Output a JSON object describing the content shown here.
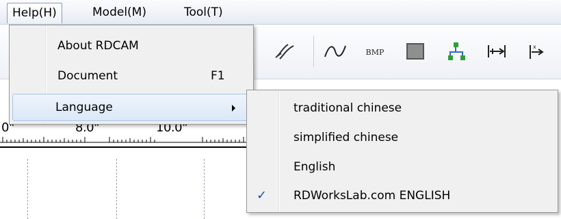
{
  "menubar": {
    "items": [
      {
        "label": "Help(H)"
      },
      {
        "label": "Model(M)"
      },
      {
        "label": "Tool(T)"
      }
    ]
  },
  "help_menu": {
    "items": [
      {
        "label": "About RDCAM",
        "shortcut": ""
      },
      {
        "label": "Document",
        "shortcut": "F1"
      },
      {
        "label": "Language",
        "shortcut": ""
      }
    ]
  },
  "language_menu": {
    "items": [
      {
        "label": "traditional chinese",
        "checked": false
      },
      {
        "label": "simplified chinese",
        "checked": false
      },
      {
        "label": "English",
        "checked": false
      },
      {
        "label": "RDWorksLab.com ENGLISH",
        "checked": true
      }
    ],
    "check_glyph": "✓"
  },
  "toolbar": {
    "bmp_label": "BMP",
    "icons": [
      "pen-icon",
      "curve-icon",
      "bmp-icon",
      "rectangle-icon",
      "node-icon",
      "align-horizontal-icon",
      "align-left-icon"
    ]
  },
  "ruler": {
    "labels": [
      "0\"",
      "8.0\"",
      "10.0\""
    ]
  },
  "colors": {
    "menu_bg": "#f0f0f0",
    "highlight": "#dbe8f7",
    "check": "#1b4fa8",
    "node_green": "#2e9e3a"
  }
}
